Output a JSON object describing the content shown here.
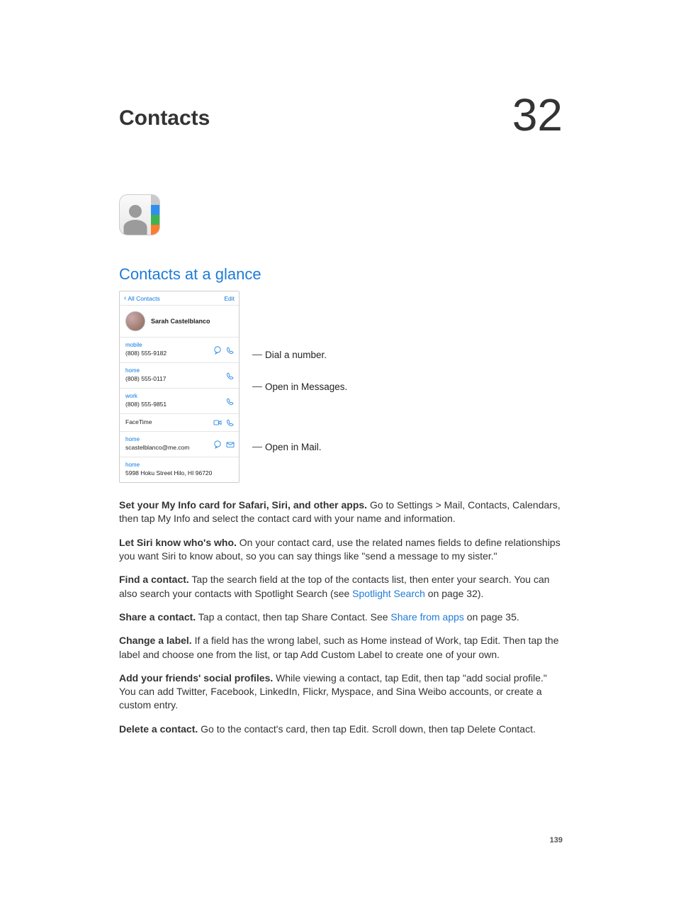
{
  "chapter": {
    "title": "Contacts",
    "number": "32"
  },
  "section_heading": "Contacts at a glance",
  "phone": {
    "back_label": "All Contacts",
    "edit_label": "Edit",
    "contact_name": "Sarah Castelblanco",
    "fields": {
      "mobile": {
        "label": "mobile",
        "value": "(808) 555-9182"
      },
      "home_phone": {
        "label": "home",
        "value": "(808) 555-0117"
      },
      "work": {
        "label": "work",
        "value": "(808) 555-9851"
      },
      "facetime_label": "FaceTime",
      "email": {
        "label": "home",
        "value": "scastelblanco@me.com"
      },
      "address": {
        "label": "home",
        "value": "5998 Hoku Street Hilo, HI 96720"
      }
    }
  },
  "callouts": {
    "dial": "Dial a number.",
    "messages": "Open in Messages.",
    "mail": "Open in Mail."
  },
  "paragraphs": {
    "p1": {
      "bold": "Set your My Info card for Safari, Siri, and other apps.",
      "rest": " Go to Settings > Mail, Contacts, Calendars, then tap My Info and select the contact card with your name and information."
    },
    "p2": {
      "bold": "Let Siri know who's who.",
      "rest": " On your contact card, use the related names fields to define relationships you want Siri to know about, so you can say things like \"send a message to my sister.\""
    },
    "p3": {
      "bold": "Find a contact.",
      "rest_before": " Tap the search field at the top of the contacts list, then enter your search. You can also search your contacts with Spotlight Search (see ",
      "link": "Spotlight Search",
      "rest_after": " on page 32)."
    },
    "p4": {
      "bold": "Share a contact.",
      "rest_before": " Tap a contact, then tap Share Contact. See ",
      "link": "Share from apps",
      "rest_after": " on page 35."
    },
    "p5": {
      "bold": "Change a label.",
      "rest": " If a field has the wrong label, such as Home instead of Work, tap Edit. Then tap the label and choose one from the list, or tap Add Custom Label to create one of your own."
    },
    "p6": {
      "bold": "Add your friends' social profiles.",
      "rest": " While viewing a contact, tap Edit, then tap \"add social profile.\" You can add Twitter, Facebook, LinkedIn, Flickr, Myspace, and Sina Weibo accounts, or create a custom entry."
    },
    "p7": {
      "bold": "Delete a contact.",
      "rest": " Go to the contact's card, then tap Edit. Scroll down, then tap Delete Contact."
    }
  },
  "page_number": "139"
}
